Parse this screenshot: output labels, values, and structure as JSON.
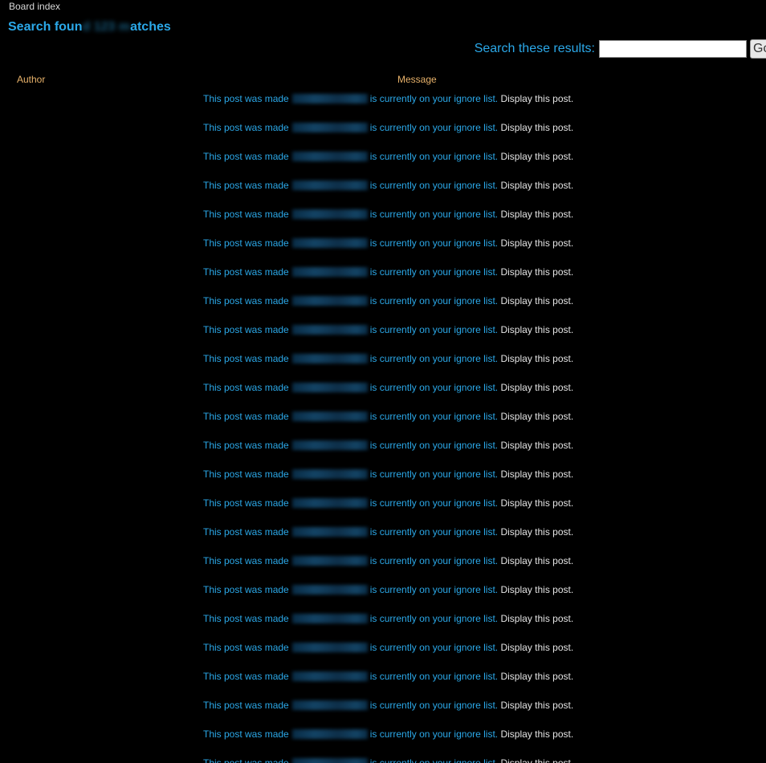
{
  "breadcrumb": {
    "board_index": "Board index"
  },
  "title": {
    "prefix": "Search foun",
    "blurred": "d 123 m",
    "suffix": "atches"
  },
  "search": {
    "label": "Search these results:",
    "value": "",
    "button_label": "Go"
  },
  "table": {
    "headers": {
      "author": "Author",
      "message": "Message"
    },
    "row_text": {
      "prefix": "This post was made",
      "suffix": "is currently on your ignore list.",
      "link": "Display this post."
    },
    "row_count": 24
  },
  "colors": {
    "background": "#000000",
    "link_blue": "#2ba8e8",
    "header_gold": "#e8b26a",
    "display_link": "#e4e4e4"
  }
}
